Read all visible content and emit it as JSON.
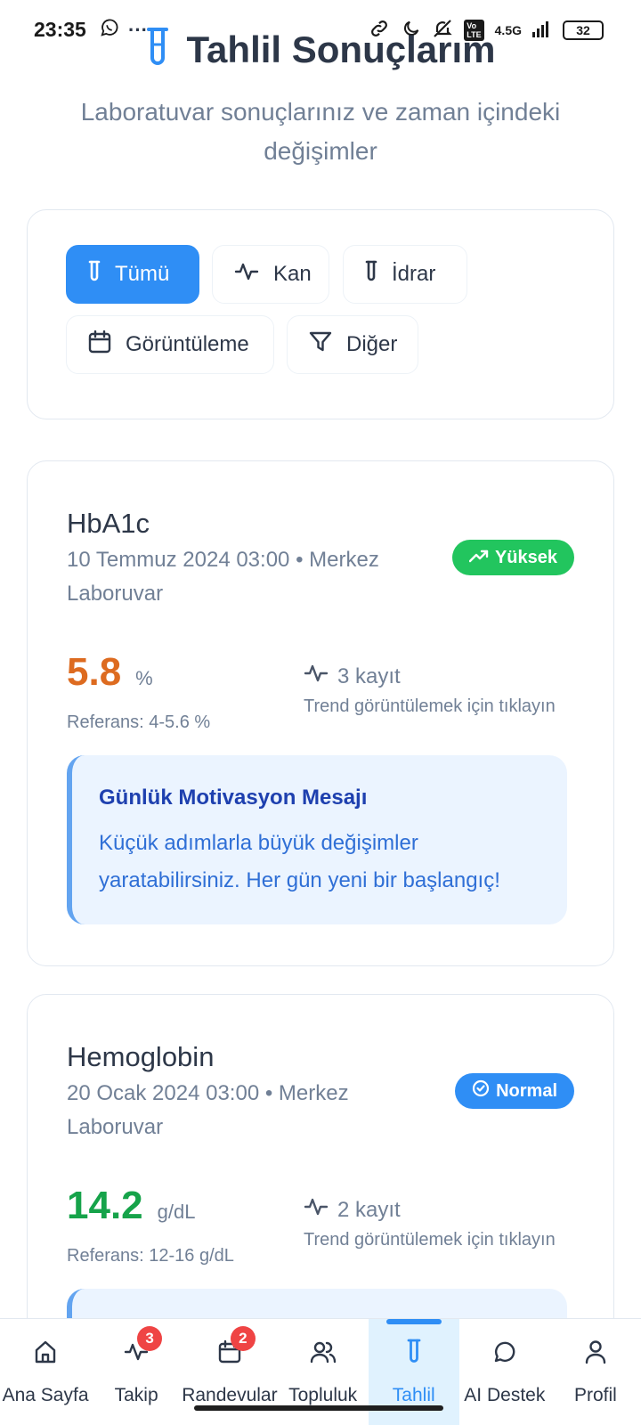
{
  "status_bar": {
    "time": "23:35",
    "dots": "···",
    "network": "4.5G",
    "battery": "32",
    "icons": [
      "whatsapp-icon",
      "link-icon",
      "moon-icon",
      "mute-icon",
      "volte-icon",
      "signal-icon"
    ]
  },
  "header": {
    "icon": "test-tube-icon",
    "title": "Tahlil Sonuçlarım",
    "subtitle": "Laboratuvar sonuçlarınız ve zaman içindeki değişimler"
  },
  "filters": [
    {
      "label": "Tümü",
      "icon": "test-tube-icon",
      "active": true
    },
    {
      "label": "Kan",
      "icon": "activity-icon",
      "active": false
    },
    {
      "label": "İdrar",
      "icon": "test-tube-icon",
      "active": false
    },
    {
      "label": "Görüntüleme",
      "icon": "calendar-icon",
      "active": false
    },
    {
      "label": "Diğer",
      "icon": "filter-icon",
      "active": false
    }
  ],
  "results": [
    {
      "name": "HbA1c",
      "meta": "10 Temmuz 2024 03:00 • Merkez Laboruvar",
      "status": "Yüksek",
      "status_icon": "trending-up-icon",
      "status_color": "#22c55e",
      "value": "5.8",
      "value_color": "#dd6b20",
      "unit": "%",
      "reference": "Referans: 4-5.6 %",
      "trend_count": "3 kayıt",
      "trend_hint": "Trend görüntülemek için tıklayın",
      "motivation_title": "Günlük Motivasyon Mesajı",
      "motivation_text": "Küçük adımlarla büyük değişimler yaratabilirsiniz. Her gün yeni bir başlangıç!"
    },
    {
      "name": "Hemoglobin",
      "meta": "20 Ocak 2024 03:00 • Merkez Laboruvar",
      "status": "Normal",
      "status_icon": "check-circle-icon",
      "status_color": "#2f8ef5",
      "value": "14.2",
      "value_color": "#16a34a",
      "unit": "g/dL",
      "reference": "Referans: 12-16 g/dL",
      "trend_count": "2 kayıt",
      "trend_hint": "Trend görüntülemek için tıklayın"
    }
  ],
  "bottom_nav": [
    {
      "label": "Ana Sayfa",
      "icon": "home-icon",
      "badge": null,
      "active": false
    },
    {
      "label": "Takip",
      "icon": "activity-icon",
      "badge": "3",
      "active": false
    },
    {
      "label": "Randevular",
      "icon": "calendar-icon",
      "badge": "2",
      "active": false
    },
    {
      "label": "Topluluk",
      "icon": "users-icon",
      "badge": null,
      "active": false
    },
    {
      "label": "Tahlil",
      "icon": "test-tube-icon",
      "badge": null,
      "active": true
    },
    {
      "label": "AI Destek",
      "icon": "chat-icon",
      "badge": null,
      "active": false
    },
    {
      "label": "Profil",
      "icon": "user-icon",
      "badge": null,
      "active": false
    }
  ],
  "colors": {
    "accent": "#2f8ef5",
    "high": "#22c55e",
    "text": "#2d3748",
    "muted": "#718096",
    "badge_red": "#ef4444"
  }
}
